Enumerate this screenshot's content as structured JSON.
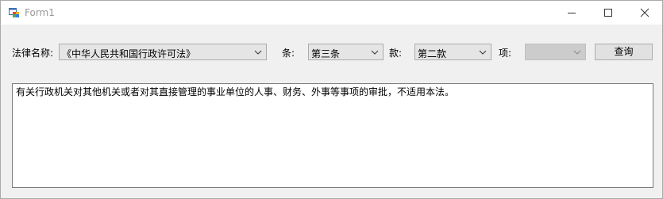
{
  "window": {
    "title": "Form1",
    "icons": {
      "app": "form-app-icon",
      "minimize": "minimize-icon",
      "maximize": "maximize-icon",
      "close": "close-icon"
    }
  },
  "form": {
    "law_label": "法律名称:",
    "law_value": "《中华人民共和国行政许可法》",
    "article_label": "条:",
    "article_value": "第三条",
    "paragraph_label": "款:",
    "paragraph_value": "第二款",
    "item_label": "项:",
    "item_value": "",
    "query_button": "查询"
  },
  "result": {
    "text": "有关行政机关对其他机关或者对其直接管理的事业单位的人事、财务、外事等事项的审批，不适用本法。"
  }
}
